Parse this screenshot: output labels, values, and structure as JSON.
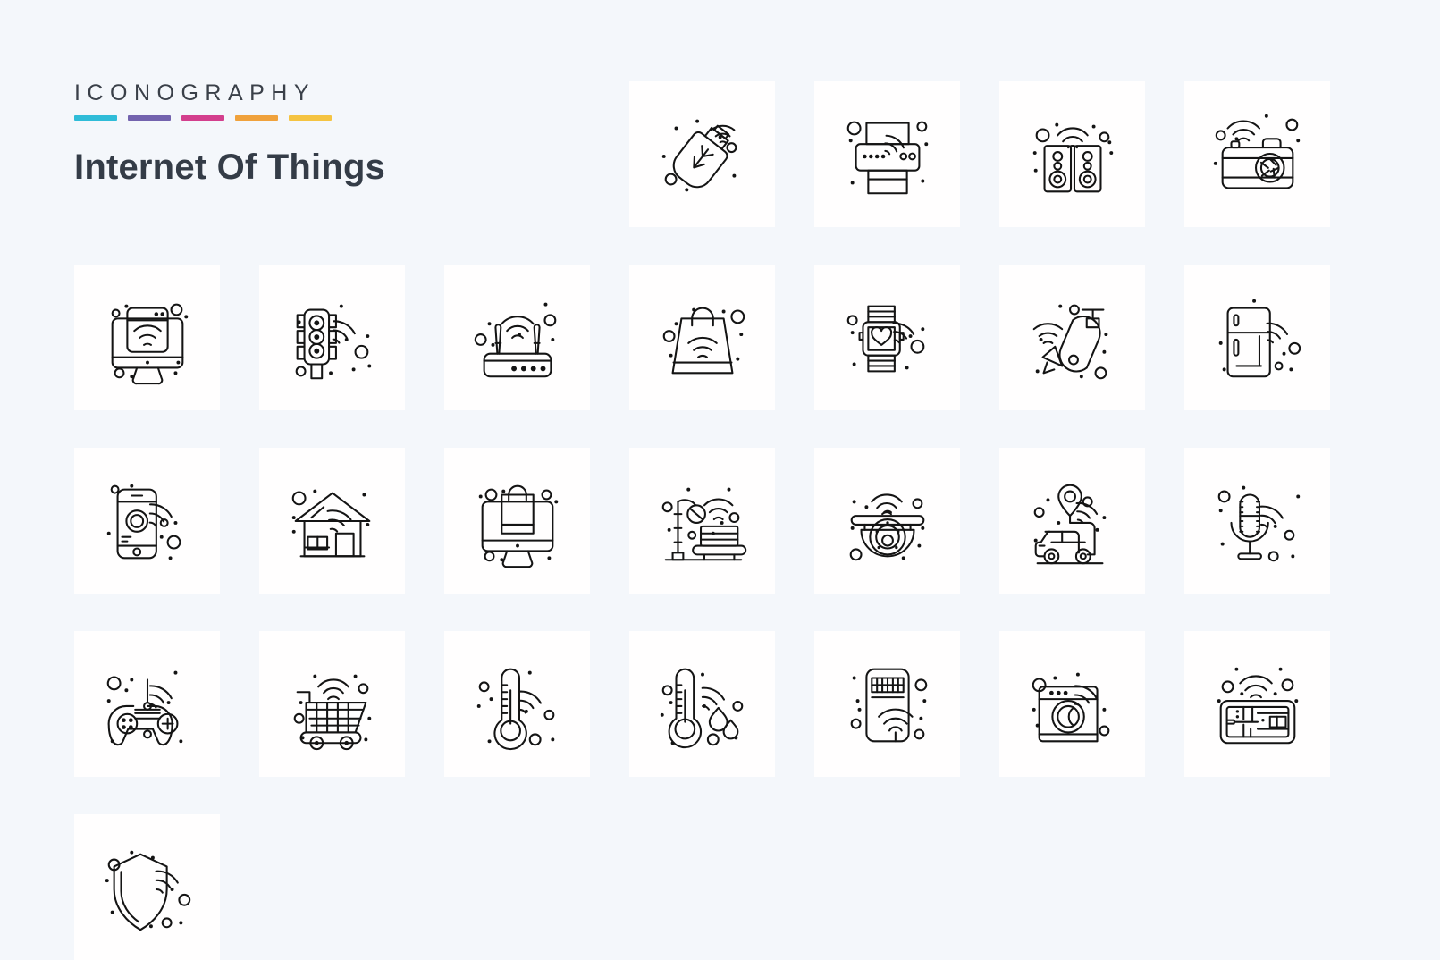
{
  "header": {
    "kicker": "ICONOGRAPHY",
    "title": "Internet Of Things",
    "rules": [
      {
        "name": "rule-cyan",
        "color": "#2fbcd8"
      },
      {
        "name": "rule-purple",
        "color": "#7363ae"
      },
      {
        "name": "rule-pink",
        "color": "#d33f8d"
      },
      {
        "name": "rule-orange",
        "color": "#f0a23c"
      },
      {
        "name": "rule-yellow",
        "color": "#f5c442"
      }
    ]
  },
  "palette": {
    "background": "#f4f7fb",
    "tile_background": "#fffefe",
    "icon_stroke": "#141414",
    "title_color": "#343c47"
  },
  "grid": {
    "columns": 7,
    "rows": 4,
    "icon_count": 25
  },
  "icons": [
    {
      "slot": 1,
      "name": "empty-slot",
      "label": ""
    },
    {
      "slot": 2,
      "name": "empty-slot",
      "label": ""
    },
    {
      "slot": 3,
      "name": "empty-slot",
      "label": ""
    },
    {
      "slot": 4,
      "name": "usb-flash-drive-icon",
      "label": "Smart USB Flash Drive"
    },
    {
      "slot": 5,
      "name": "wireless-printer-icon",
      "label": "Wireless Printer"
    },
    {
      "slot": 6,
      "name": "smart-speakers-icon",
      "label": "Smart Speakers"
    },
    {
      "slot": 7,
      "name": "smart-camera-icon",
      "label": "Smart Camera"
    },
    {
      "slot": 8,
      "name": "smart-monitor-icon",
      "label": "Connected Monitor"
    },
    {
      "slot": 9,
      "name": "smart-traffic-light-icon",
      "label": "Smart Traffic Light"
    },
    {
      "slot": 10,
      "name": "wifi-router-icon",
      "label": "Wi-Fi Router"
    },
    {
      "slot": 11,
      "name": "smart-shopping-bag-icon",
      "label": "Smart Shopping Bag"
    },
    {
      "slot": 12,
      "name": "smartwatch-heart-icon",
      "label": "Smartwatch Health"
    },
    {
      "slot": 13,
      "name": "cctv-camera-icon",
      "label": "CCTV Security Camera"
    },
    {
      "slot": 14,
      "name": "smart-refrigerator-icon",
      "label": "Smart Refrigerator"
    },
    {
      "slot": 15,
      "name": "smartphone-wifi-icon",
      "label": "Connected Smartphone"
    },
    {
      "slot": 16,
      "name": "smart-home-icon",
      "label": "Smart Home"
    },
    {
      "slot": 17,
      "name": "online-shopping-icon",
      "label": "Online Shopping"
    },
    {
      "slot": 18,
      "name": "smart-street-light-icon",
      "label": "Smart Street Light"
    },
    {
      "slot": 19,
      "name": "dome-security-camera-icon",
      "label": "Dome Security Camera"
    },
    {
      "slot": 20,
      "name": "connected-car-icon",
      "label": "Connected Car Navigation"
    },
    {
      "slot": 21,
      "name": "smart-microphone-icon",
      "label": "Smart Microphone"
    },
    {
      "slot": 22,
      "name": "game-controller-icon",
      "label": "Wireless Game Controller"
    },
    {
      "slot": 23,
      "name": "smart-shopping-cart-icon",
      "label": "Smart Shopping Cart"
    },
    {
      "slot": 24,
      "name": "smart-thermometer-icon",
      "label": "Smart Thermometer"
    },
    {
      "slot": 25,
      "name": "thermometer-humidity-icon",
      "label": "Temperature And Humidity Sensor"
    },
    {
      "slot": 26,
      "name": "smartphone-touch-wifi-icon",
      "label": "Smartphone Wi-Fi Touch"
    },
    {
      "slot": 27,
      "name": "smart-washing-machine-icon",
      "label": "Smart Washing Machine"
    },
    {
      "slot": 28,
      "name": "gps-map-icon",
      "label": "GPS Map Navigation"
    },
    {
      "slot": 29,
      "name": "security-shield-icon",
      "label": "Network Security Shield"
    }
  ]
}
